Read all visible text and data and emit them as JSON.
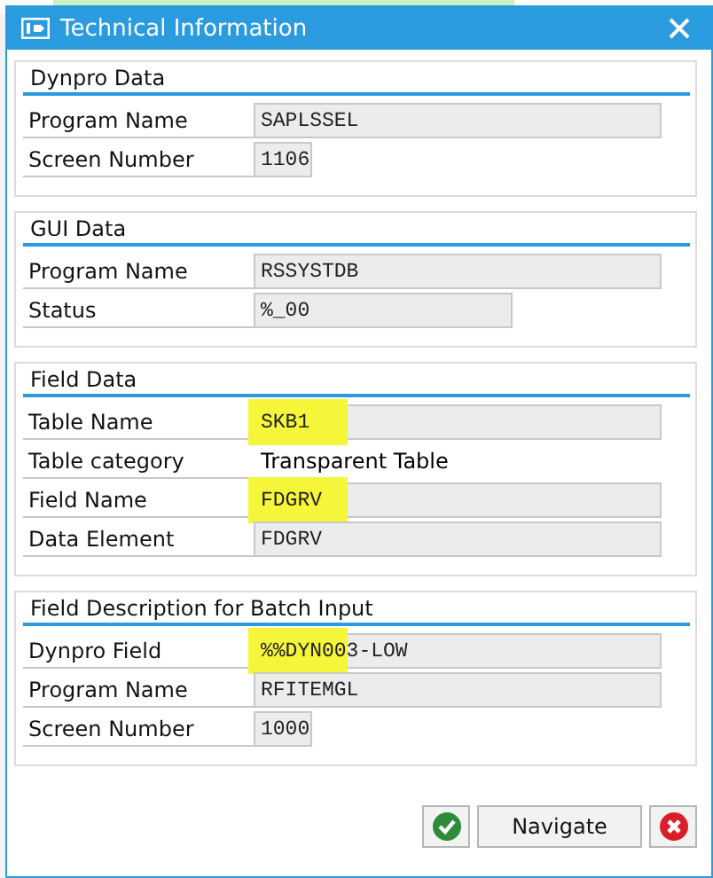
{
  "window": {
    "title": "Technical Information"
  },
  "groups": [
    {
      "title": "Dynpro Data",
      "rows": [
        {
          "label": "Program Name",
          "value": "SAPLSSEL",
          "kind": "long",
          "highlighted": false
        },
        {
          "label": "Screen Number",
          "value": "1106",
          "kind": "short",
          "highlighted": false
        }
      ]
    },
    {
      "title": "GUI Data",
      "rows": [
        {
          "label": "Program Name",
          "value": "RSSYSTDB",
          "kind": "long",
          "highlighted": false
        },
        {
          "label": "Status",
          "value": "%_00",
          "kind": "medium",
          "highlighted": false
        }
      ]
    },
    {
      "title": "Field Data",
      "rows": [
        {
          "label": "Table Name",
          "value": "SKB1",
          "kind": "long",
          "highlighted": true
        },
        {
          "label": "Table category",
          "value": "Transparent Table",
          "kind": "text",
          "highlighted": false
        },
        {
          "label": "Field Name",
          "value": "FDGRV",
          "kind": "long",
          "highlighted": true
        },
        {
          "label": "Data Element",
          "value": "FDGRV",
          "kind": "long",
          "highlighted": false
        }
      ]
    },
    {
      "title": "Field Description for Batch Input",
      "rows": [
        {
          "label": "Dynpro Field",
          "value": "%%DYN003-LOW",
          "kind": "long",
          "highlighted": true
        },
        {
          "label": "Program Name",
          "value": "RFITEMGL",
          "kind": "long",
          "highlighted": false
        },
        {
          "label": "Screen Number",
          "value": "1000",
          "kind": "short",
          "highlighted": false
        }
      ]
    }
  ],
  "buttons": [
    {
      "kind": "confirm"
    },
    {
      "kind": "text",
      "label": "Navigate"
    },
    {
      "kind": "cancel"
    }
  ]
}
